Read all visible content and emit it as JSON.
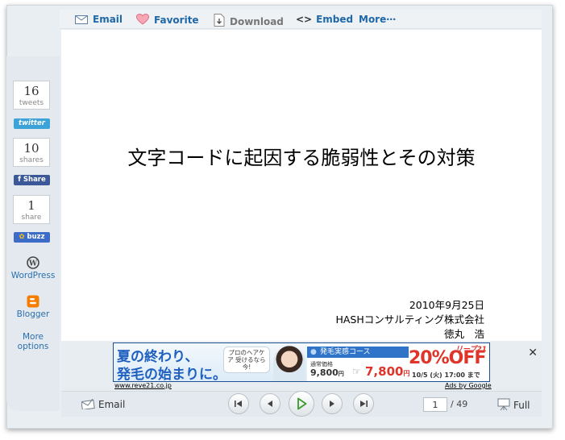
{
  "toolbar": {
    "email": "Email",
    "favorite": "Favorite",
    "download": "Download",
    "embed": "Embed",
    "more": "More⋯",
    "embed_icon": "<>"
  },
  "sidebar": {
    "tweets": {
      "count": "16",
      "label": "tweets",
      "button": "twitter"
    },
    "shares": {
      "count": "10",
      "label": "shares",
      "button": "f Share"
    },
    "share": {
      "count": "1",
      "label": "share",
      "button": "buzz"
    },
    "wordpress": "WordPress",
    "blogger": "Blogger",
    "more_options": [
      "More",
      "options"
    ]
  },
  "slide": {
    "title": "文字コードに起因する脆弱性とその対策",
    "date": "2010年9月25日",
    "company": "HASHコンサルティング株式会社",
    "author": "徳丸　浩"
  },
  "ad": {
    "headline_1": "夏の終わり、",
    "headline_2": "発毛の始まりに。",
    "bubble": "プロのヘアケア 受けるなら今!",
    "course": "発毛実感コース",
    "price_label": "通常価格",
    "old_price": "9,800",
    "new_price": "7,800",
    "yen": "円",
    "discount": "20%OFF",
    "brand": "リーブ21",
    "deadline": "10/5 (火) 17:00 まで",
    "site": "www.reve21.co.jp",
    "ads_by": "Ads by Google",
    "close": "✕"
  },
  "footer": {
    "email": "Email",
    "page_current": "1",
    "page_total": "/ 49",
    "full": "Full"
  },
  "colors": {
    "link": "#1f68a8",
    "twitter": "#3ba3d8",
    "facebook": "#3b5998",
    "buzz": "#3d6bc8",
    "ad_blue": "#2f74c8",
    "ad_red": "#e0332a",
    "play_green": "#3a9a2a"
  },
  "icons": [
    "mail-icon",
    "heart-icon",
    "download-icon",
    "code-icon",
    "wordpress-icon",
    "blogger-icon",
    "first-icon",
    "prev-icon",
    "play-icon",
    "next-icon",
    "last-icon",
    "fullscreen-icon",
    "close-icon"
  ]
}
